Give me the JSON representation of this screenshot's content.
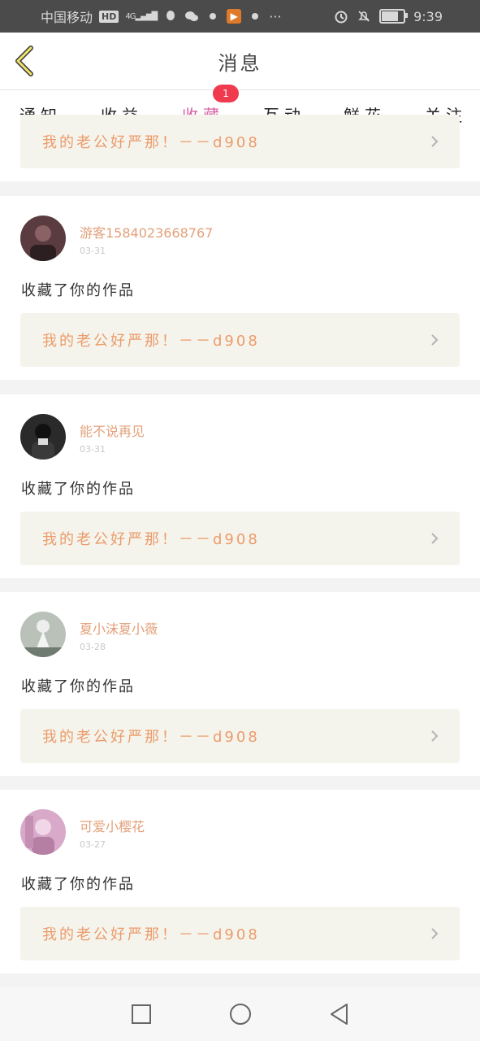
{
  "status_bar": {
    "carrier": "中国移动",
    "hd": "HD",
    "network": "4G",
    "time": "9:39",
    "battery_level": 0.7
  },
  "header": {
    "title": "消息"
  },
  "tabs": [
    {
      "label": "通知"
    },
    {
      "label": "收益"
    },
    {
      "label": "收藏",
      "active": true,
      "badge": "1"
    },
    {
      "label": "互动"
    },
    {
      "label": "鲜花"
    },
    {
      "label": "关注"
    }
  ],
  "partial_item": {
    "work_title": "我的老公好严那！－－d908"
  },
  "items": [
    {
      "user": "游客1584023668767",
      "date": "03-31",
      "action": "收藏了你的作品",
      "work_title": "我的老公好严那！－－d908",
      "avatar_color": "#5a3b3f"
    },
    {
      "user": "能不说再见",
      "date": "03-31",
      "action": "收藏了你的作品",
      "work_title": "我的老公好严那！－－d908",
      "avatar_color": "#2a2a2a"
    },
    {
      "user": "夏小沫夏小薇",
      "date": "03-28",
      "action": "收藏了你的作品",
      "work_title": "我的老公好严那！－－d908",
      "avatar_color": "#b9c1b9"
    },
    {
      "user": "可爱小樱花",
      "date": "03-27",
      "action": "收藏了你的作品",
      "work_title": "我的老公好严那！－－d908",
      "avatar_color": "#d8a9c9"
    }
  ],
  "navbar": {
    "icons": [
      "square-icon",
      "circle-icon",
      "triangle-back-icon"
    ]
  }
}
